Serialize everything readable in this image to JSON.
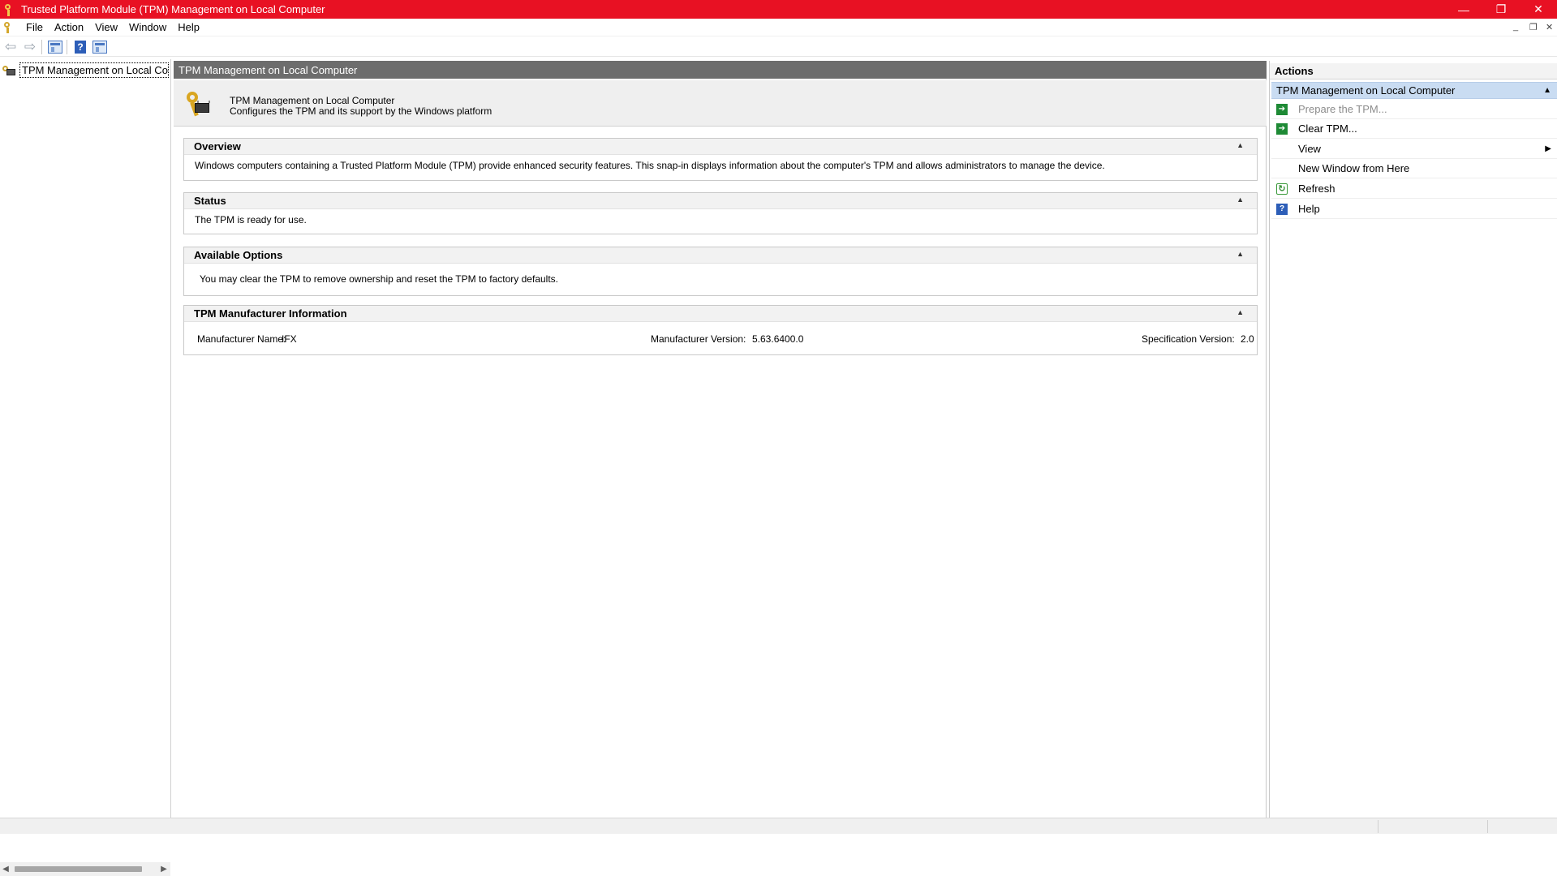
{
  "window": {
    "title": "Trusted Platform Module (TPM) Management on Local Computer",
    "controls": {
      "minimize": "—",
      "restore": "❐",
      "close": "✕"
    }
  },
  "menubar": {
    "items": [
      "File",
      "Action",
      "View",
      "Window",
      "Help"
    ],
    "mdi_controls": {
      "minimize": "_",
      "restore": "❐",
      "close": "✕"
    }
  },
  "toolbar": {
    "back_glyph": "⇦",
    "forward_glyph": "⇨",
    "help_glyph": "?"
  },
  "tree": {
    "root_label": "TPM Management on Local Comp",
    "scroll": {
      "left": "◀",
      "right": "▶"
    }
  },
  "center": {
    "header": "TPM Management on Local Computer",
    "banner": {
      "title": "TPM Management on Local Computer",
      "description": "Configures the TPM and its support by the Windows platform"
    },
    "sections": {
      "overview": {
        "title": "Overview",
        "text": "Windows computers containing a Trusted Platform Module (TPM) provide enhanced security features. This snap-in displays information about the computer's TPM and allows administrators to manage the device."
      },
      "status": {
        "title": "Status",
        "text": "The TPM is ready for use."
      },
      "options": {
        "title": "Available Options",
        "text": "You may clear the TPM to remove ownership and reset the TPM to factory defaults."
      },
      "manufacturer": {
        "title": "TPM Manufacturer Information",
        "name_label": "Manufacturer Name:",
        "name_value": "IFX",
        "version_label": "Manufacturer Version:",
        "version_value": "5.63.6400.0",
        "spec_label": "Specification Version:",
        "spec_value": "2.0"
      },
      "caret": "▲"
    }
  },
  "actions": {
    "title": "Actions",
    "group": "TPM Management on Local Computer",
    "group_caret": "▲",
    "items": {
      "prepare": "Prepare the TPM...",
      "clear": "Clear TPM...",
      "view": "View",
      "new_window": "New Window from Here",
      "refresh": "Refresh",
      "help": "Help"
    },
    "submenu_glyph": "▶",
    "icon_glyphs": {
      "arrow": "➔",
      "refresh": "↻",
      "help": "?"
    }
  }
}
